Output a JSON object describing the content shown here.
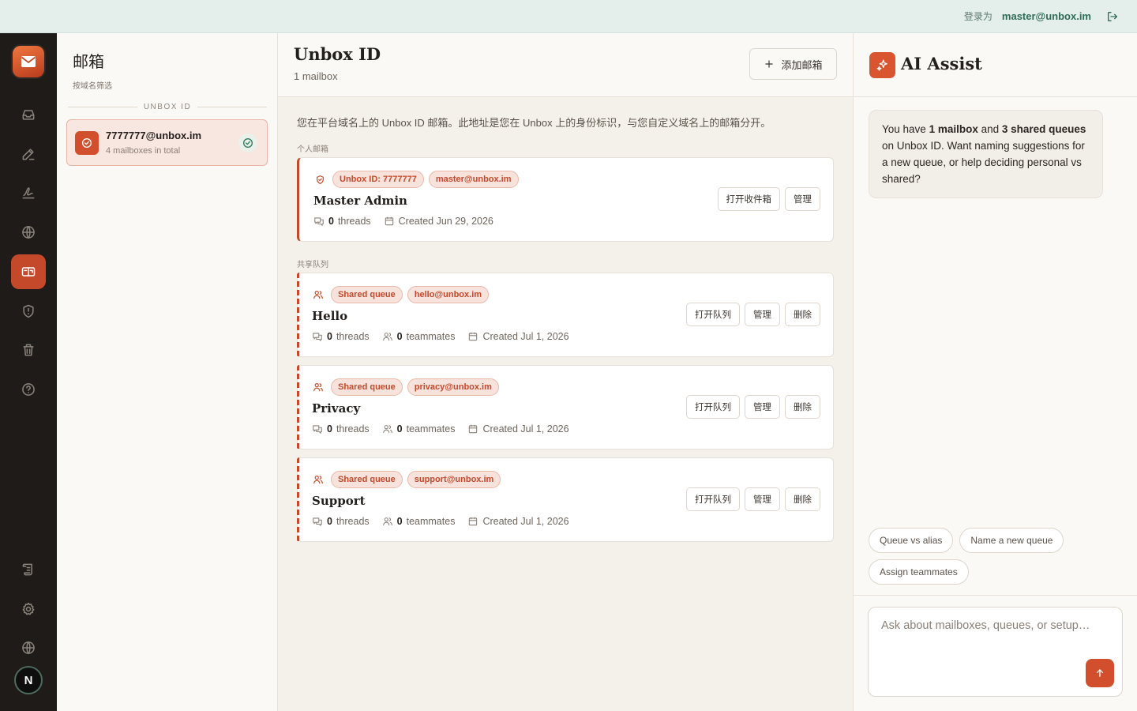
{
  "topbar": {
    "login_label": "登录为",
    "login_email": "master@unbox.im",
    "logout_icon": "logout-icon"
  },
  "rail": {
    "items": [
      "inbox-icon",
      "compose-icon",
      "signature-icon",
      "globe-icon",
      "mailbox-icon",
      "shield-icon",
      "trash-icon",
      "help-icon",
      "scroll-icon",
      "settings-icon",
      "language-icon"
    ],
    "active": "mailbox-icon",
    "avatar_initial": "N"
  },
  "list": {
    "title": "邮箱",
    "filter_label": "按域名筛选",
    "group_label": "UNBOX ID",
    "item": {
      "email": "7777777@unbox.im",
      "subtitle": "4 mailboxes in total"
    }
  },
  "main": {
    "title": "Unbox ID",
    "count": "1 mailbox",
    "add_button": "添加邮箱",
    "description": "您在平台域名上的 Unbox ID 邮箱。此地址是您在 Unbox 上的身份标识，与您自定义域名上的邮箱分开。",
    "personal_label": "个人邮箱",
    "shared_label": "共享队列",
    "personal": {
      "tags": [
        "Unbox ID: 7777777",
        "master@unbox.im"
      ],
      "name": "Master Admin",
      "threads_count": "0",
      "threads_label": "threads",
      "created": "Created Jun 29, 2026",
      "open_button": "打开收件箱",
      "manage_button": "管理"
    },
    "queues": [
      {
        "tag": "Shared queue",
        "email": "hello@unbox.im",
        "name": "Hello",
        "threads_count": "0",
        "threads_label": "threads",
        "teammates_count": "0",
        "teammates_label": "teammates",
        "created": "Created Jul 1, 2026",
        "open_button": "打开队列",
        "manage_button": "管理",
        "delete_button": "删除"
      },
      {
        "tag": "Shared queue",
        "email": "privacy@unbox.im",
        "name": "Privacy",
        "threads_count": "0",
        "threads_label": "threads",
        "teammates_count": "0",
        "teammates_label": "teammates",
        "created": "Created Jul 1, 2026",
        "open_button": "打开队列",
        "manage_button": "管理",
        "delete_button": "删除"
      },
      {
        "tag": "Shared queue",
        "email": "support@unbox.im",
        "name": "Support",
        "threads_count": "0",
        "threads_label": "threads",
        "teammates_count": "0",
        "teammates_label": "teammates",
        "created": "Created Jul 1, 2026",
        "open_button": "打开队列",
        "manage_button": "管理",
        "delete_button": "删除"
      }
    ]
  },
  "ai": {
    "title": "AI Assist",
    "message": {
      "p1": "You have ",
      "b1": "1 mailbox",
      "p2": " and ",
      "b2": "3 shared queues",
      "p3": " on Unbox ID. Want naming suggestions for a new queue, or help deciding personal vs shared?"
    },
    "chips": [
      "Queue vs alias",
      "Name a new queue",
      "Assign teammates"
    ],
    "input_placeholder": "Ask about mailboxes, queues, or setup…"
  },
  "colors": {
    "accent": "#c4492a",
    "rail_bg": "#1f1b18",
    "topbar_bg": "#e4eeea"
  }
}
